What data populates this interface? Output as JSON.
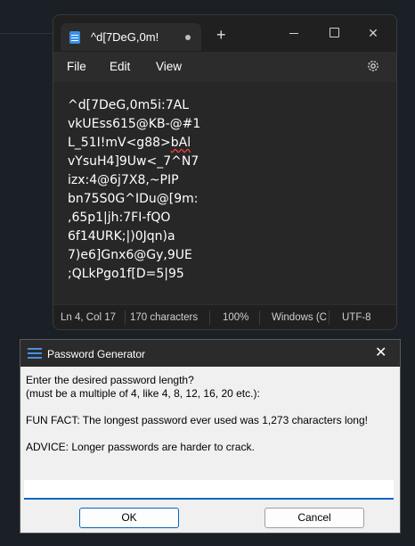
{
  "notepad": {
    "tab_title": "^d[7DeG,0m!",
    "plus": "+",
    "close_glyph": "✕",
    "menu": {
      "file": "File",
      "edit": "Edit",
      "view": "View"
    },
    "content_before": "^d[7DeG,0m5i:7AL\nvkUEss615@KB-@#1\nL_51I!mV<g88>",
    "content_squiggle": "bAl",
    "content_after": "\nvYsuH4]9Uw<_7^N7\nizx:4@6j7X8,~PIP\nbn75S0G^IDu@[9m:\n,65p1|jh:7FI-fQO\n6f14URK;|)0Jqn)a\n7)e6]Gnx6@Gy,9UE\n;QLkPgo1f[D=5|95",
    "status": {
      "position": "Ln 4, Col 17",
      "characters": "170 characters",
      "zoom": "100%",
      "line_ending": "Windows (C",
      "encoding": "UTF-8"
    }
  },
  "dialog": {
    "title": "Password Generator",
    "close_glyph": "✕",
    "message": "Enter the desired password length?\n(must be a multiple of 4, like 4, 8, 12, 16, 20 etc.):\n\nFUN FACT: The longest password ever used was 1,273 characters long!\n\nADVICE: Longer passwords are harder to crack.",
    "input_value": "",
    "ok_label": "OK",
    "cancel_label": "Cancel"
  }
}
